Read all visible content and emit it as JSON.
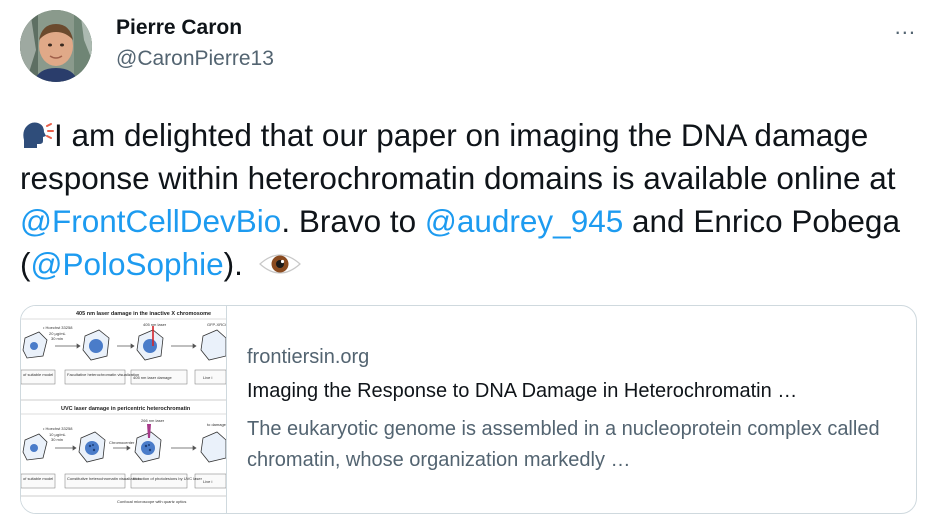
{
  "author": {
    "name": "Pierre Caron",
    "handle": "@CaronPierre13"
  },
  "menu": {
    "more_icon": "..."
  },
  "tweet": {
    "speaking_emoji": "speaking-head-icon",
    "text_1": "I am delighted that our paper on imaging the DNA damage response within heterochromatin domains is available online at ",
    "mention_1": "@FrontCellDevBio",
    "text_2": ". Bravo to ",
    "mention_2": "@audrey_945",
    "text_3": "  and Enrico Pobega (",
    "mention_3": "@PoloSophie",
    "text_4": "). ",
    "eye_emoji": "eye-icon"
  },
  "card": {
    "domain": "frontiersin.org",
    "title": "Imaging the Response to DNA Damage in Heterochromatin …",
    "description": "The eukaryotic genome is assembled in a nucleoprotein complex called chromatin, whose organization markedly …",
    "figure": {
      "top_heading": "405 nm laser damage in the inactive X chromosome",
      "bottom_heading": "UVC laser damage in pericentric heterochromatin",
      "top_labels": [
        "of suitable model",
        "Facultative heterochromatin visualization",
        "405 nm laser damage",
        "Live i"
      ],
      "bottom_labels": [
        "of suitable model",
        "Constitutive heterochromatin visualization",
        "Induction of photolesions by UVC laser",
        "Live i"
      ],
      "footer": "Confocal microscope with quartz optics"
    }
  }
}
